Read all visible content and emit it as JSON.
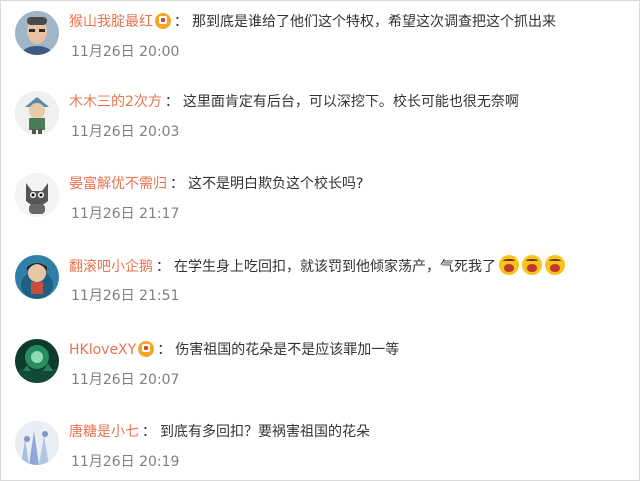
{
  "comments": [
    {
      "user": "猴山我腚最红",
      "text": "那到底是谁给了他们这个特权，希望这次调查把这个抓出来",
      "time": "11月26日 20:00"
    },
    {
      "user": "木木三的2次方",
      "text": "这里面肯定有后台，可以深挖下。校长可能也很无奈啊",
      "time": "11月26日 20:03"
    },
    {
      "user": "晏富解优不需归",
      "text": "这不是明白欺负这个校长吗?",
      "time": "11月26日 21:17"
    },
    {
      "user": "翻滚吧小企鹅",
      "text": "在学生身上吃回扣，就该罚到他倾家荡产，气死我了",
      "time": "11月26日 21:51"
    },
    {
      "user": "HKloveXY",
      "text": "伤害祖国的花朵是不是应该罪加一等",
      "time": "11月26日 20:07"
    },
    {
      "user": "唐糖是小七",
      "text": "到底有多回扣？要祸害祖国的花朵",
      "time": "11月26日 20:19"
    }
  ],
  "separator": "：",
  "colors": {
    "username": "#eb7350",
    "time": "#808080",
    "text": "#333333",
    "badge": "#f5a623",
    "emoji": "#f7c21a"
  },
  "icons": {
    "badge": "vip-badge-icon",
    "emoji": "angry-face-emoji-icon"
  }
}
